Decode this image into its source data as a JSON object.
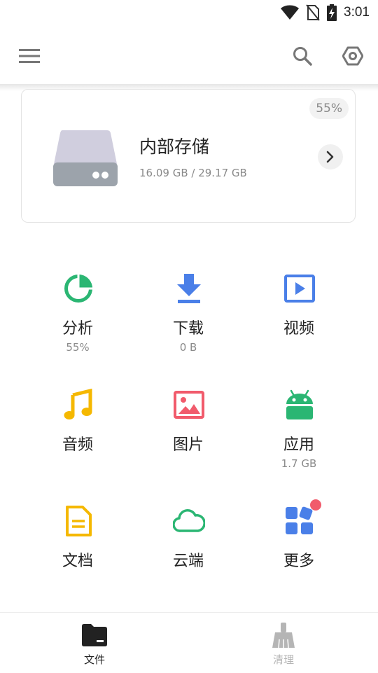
{
  "status_bar": {
    "time": "3:01"
  },
  "storage": {
    "title": "内部存储",
    "usage": "16.09 GB / 29.17 GB",
    "percent": "55%",
    "used_fraction": 0.55
  },
  "categories": [
    {
      "label": "分析",
      "sub": "55%",
      "icon": "pie-chart-icon",
      "color": "#2bb673"
    },
    {
      "label": "下载",
      "sub": "0 B",
      "icon": "download-icon",
      "color": "#4a7fe8"
    },
    {
      "label": "视频",
      "sub": "",
      "icon": "video-icon",
      "color": "#4a7fe8"
    },
    {
      "label": "音频",
      "sub": "",
      "icon": "music-note-icon",
      "color": "#f5b800"
    },
    {
      "label": "图片",
      "sub": "",
      "icon": "image-icon",
      "color": "#f15b6c"
    },
    {
      "label": "应用",
      "sub": "1.7 GB",
      "icon": "android-icon",
      "color": "#2bb673"
    },
    {
      "label": "文档",
      "sub": "",
      "icon": "document-icon",
      "color": "#f5b800"
    },
    {
      "label": "云端",
      "sub": "",
      "icon": "cloud-icon",
      "color": "#2bb673"
    },
    {
      "label": "更多",
      "sub": "",
      "icon": "apps-icon",
      "color": "#4a7fe8"
    }
  ],
  "bottom_nav": {
    "items": [
      {
        "label": "文件",
        "active": true,
        "icon": "folder-icon"
      },
      {
        "label": "清理",
        "active": false,
        "icon": "broom-icon"
      }
    ]
  },
  "colors": {
    "active": "#222222",
    "inactive": "#b5b5b5",
    "badge": "#f15b6c"
  }
}
